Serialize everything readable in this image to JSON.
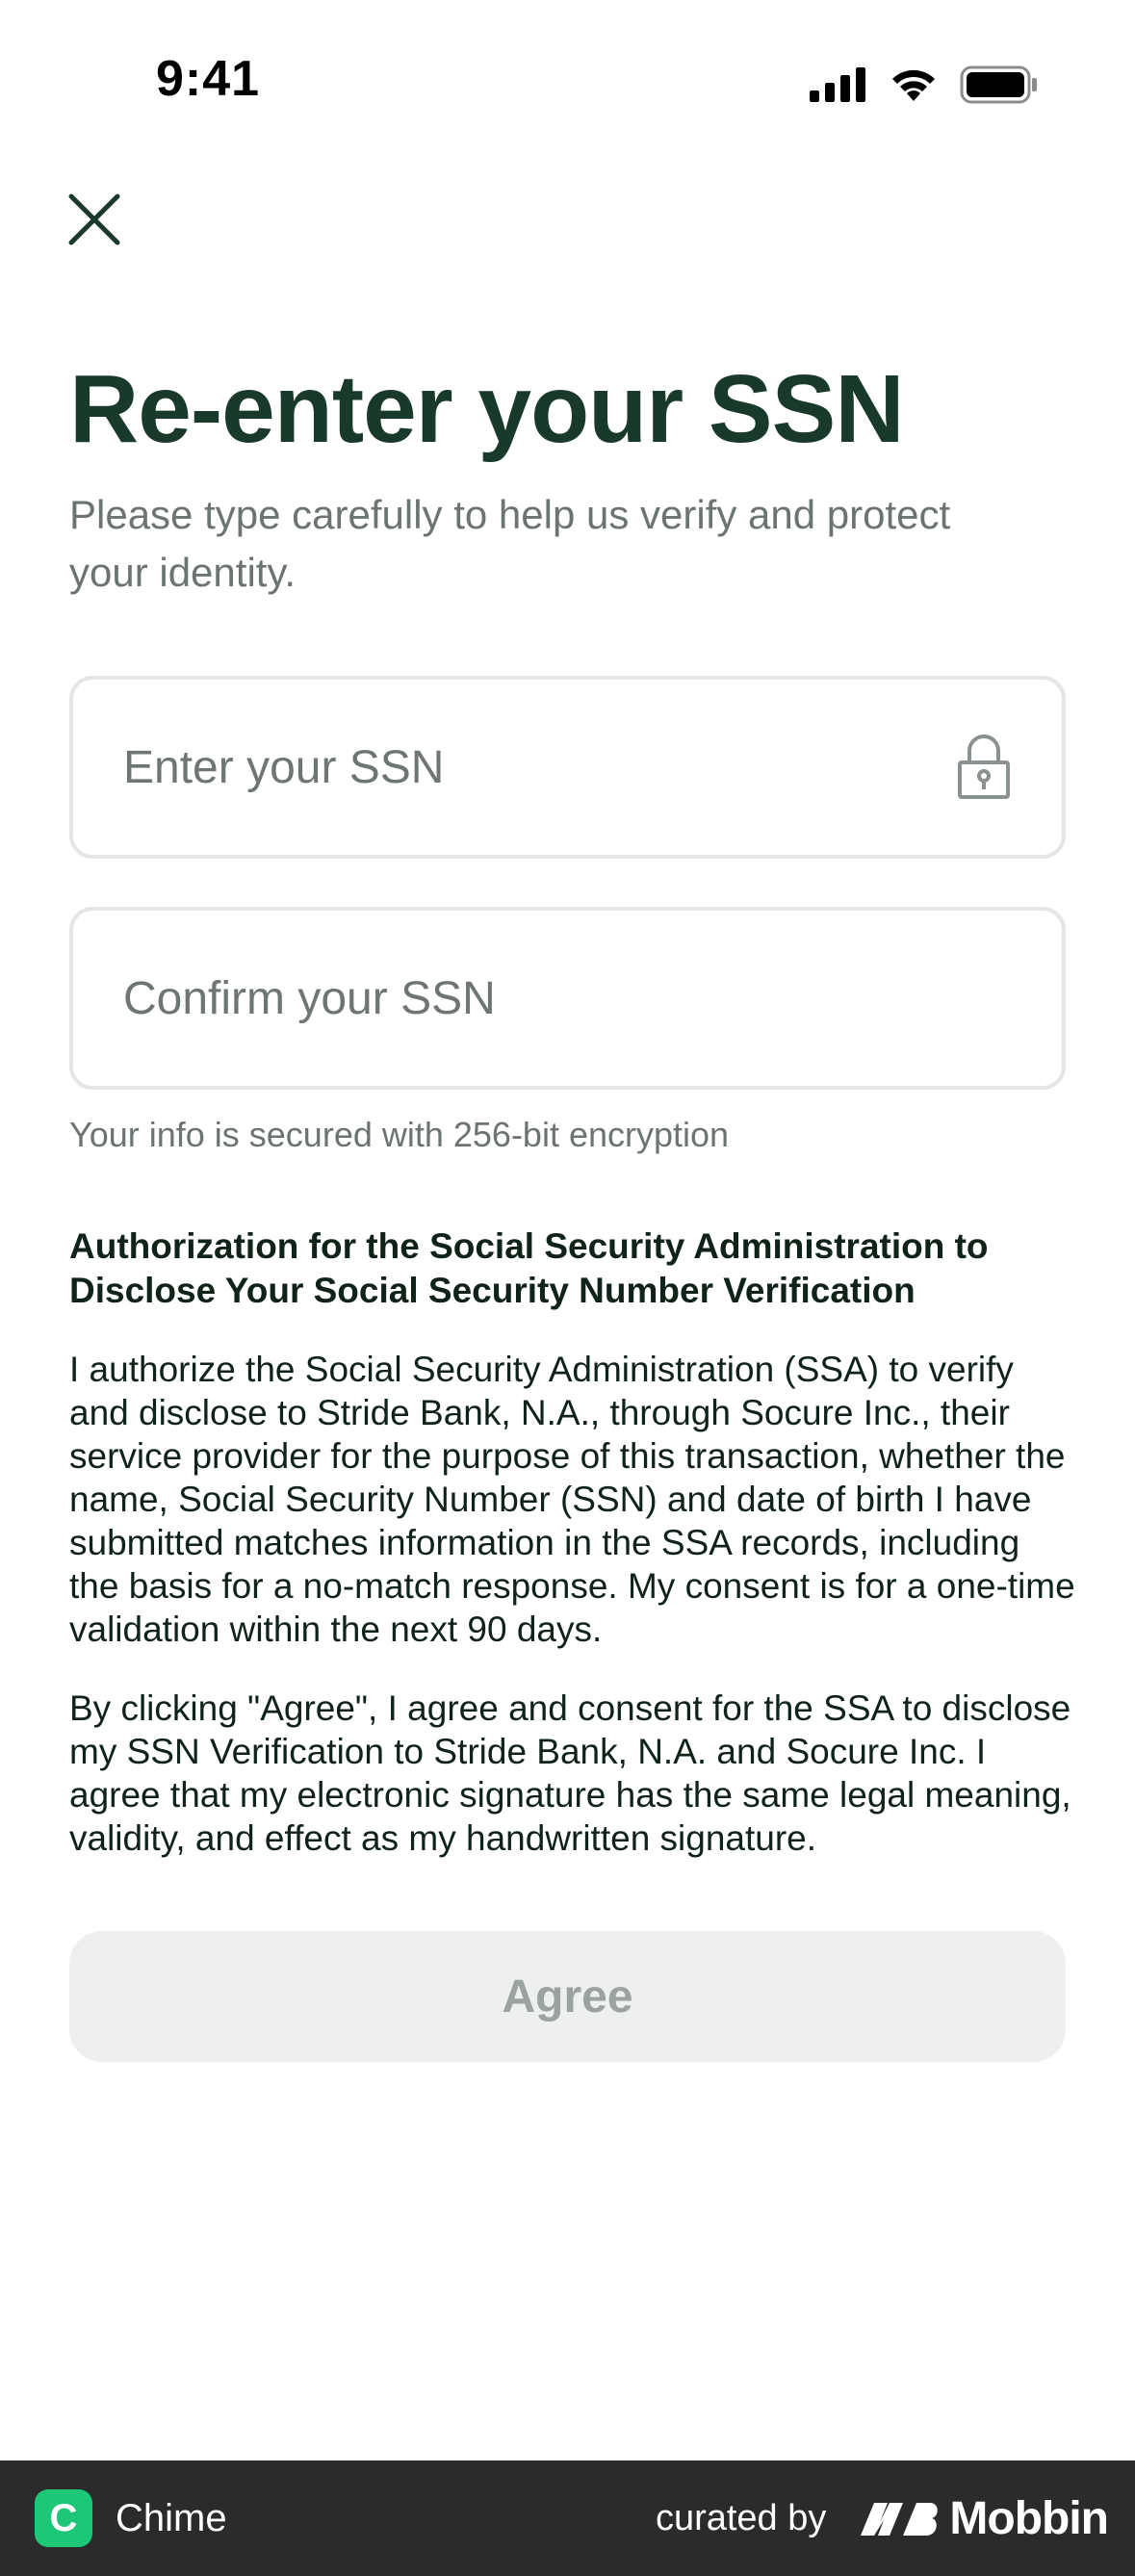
{
  "status_bar": {
    "time": "9:41"
  },
  "header": {
    "title": "Re-enter your SSN",
    "subtitle": "Please type carefully to help us verify and protect your identity."
  },
  "form": {
    "ssn_placeholder": "Enter your SSN",
    "ssn_value": "",
    "confirm_placeholder": "Confirm your SSN",
    "confirm_value": "",
    "security_note": "Your info is secured with 256-bit encryption"
  },
  "authorization": {
    "heading": "Authorization for the Social Security Administration to Disclose Your Social Security Number Verification",
    "paragraph_1": "I authorize the Social Security Administration (SSA) to verify and disclose to Stride Bank, N.A., through Socure Inc., their service provider for the purpose of this transaction, whether the name, Social Security Number (SSN) and date of birth I have submitted matches information in the SSA records, including the basis for a no-match response. My consent is for a one-time validation within the next 90 days.",
    "paragraph_2": "By clicking \"Agree\", I agree and consent for the SSA to disclose my SSN Verification to Stride Bank, N.A. and Socure Inc. I agree that my electronic signature has the same legal meaning, validity, and effect as my handwritten signature."
  },
  "actions": {
    "agree_label": "Agree"
  },
  "footer": {
    "app_logo_letter": "C",
    "app_name": "Chime",
    "curated_by": "curated by",
    "brand": "Mobbin"
  },
  "colors": {
    "title": "#19392a",
    "muted": "#6b7470",
    "field_border": "#e4e6e5",
    "button_disabled_bg": "#eeefef",
    "button_disabled_text": "#9aa39f",
    "chime_green": "#1ec677",
    "footer_bg": "#2b2b2b"
  },
  "icons": [
    "close-icon",
    "lock-icon",
    "signal-icon",
    "wifi-icon",
    "battery-icon",
    "mobbin-logo-icon"
  ]
}
